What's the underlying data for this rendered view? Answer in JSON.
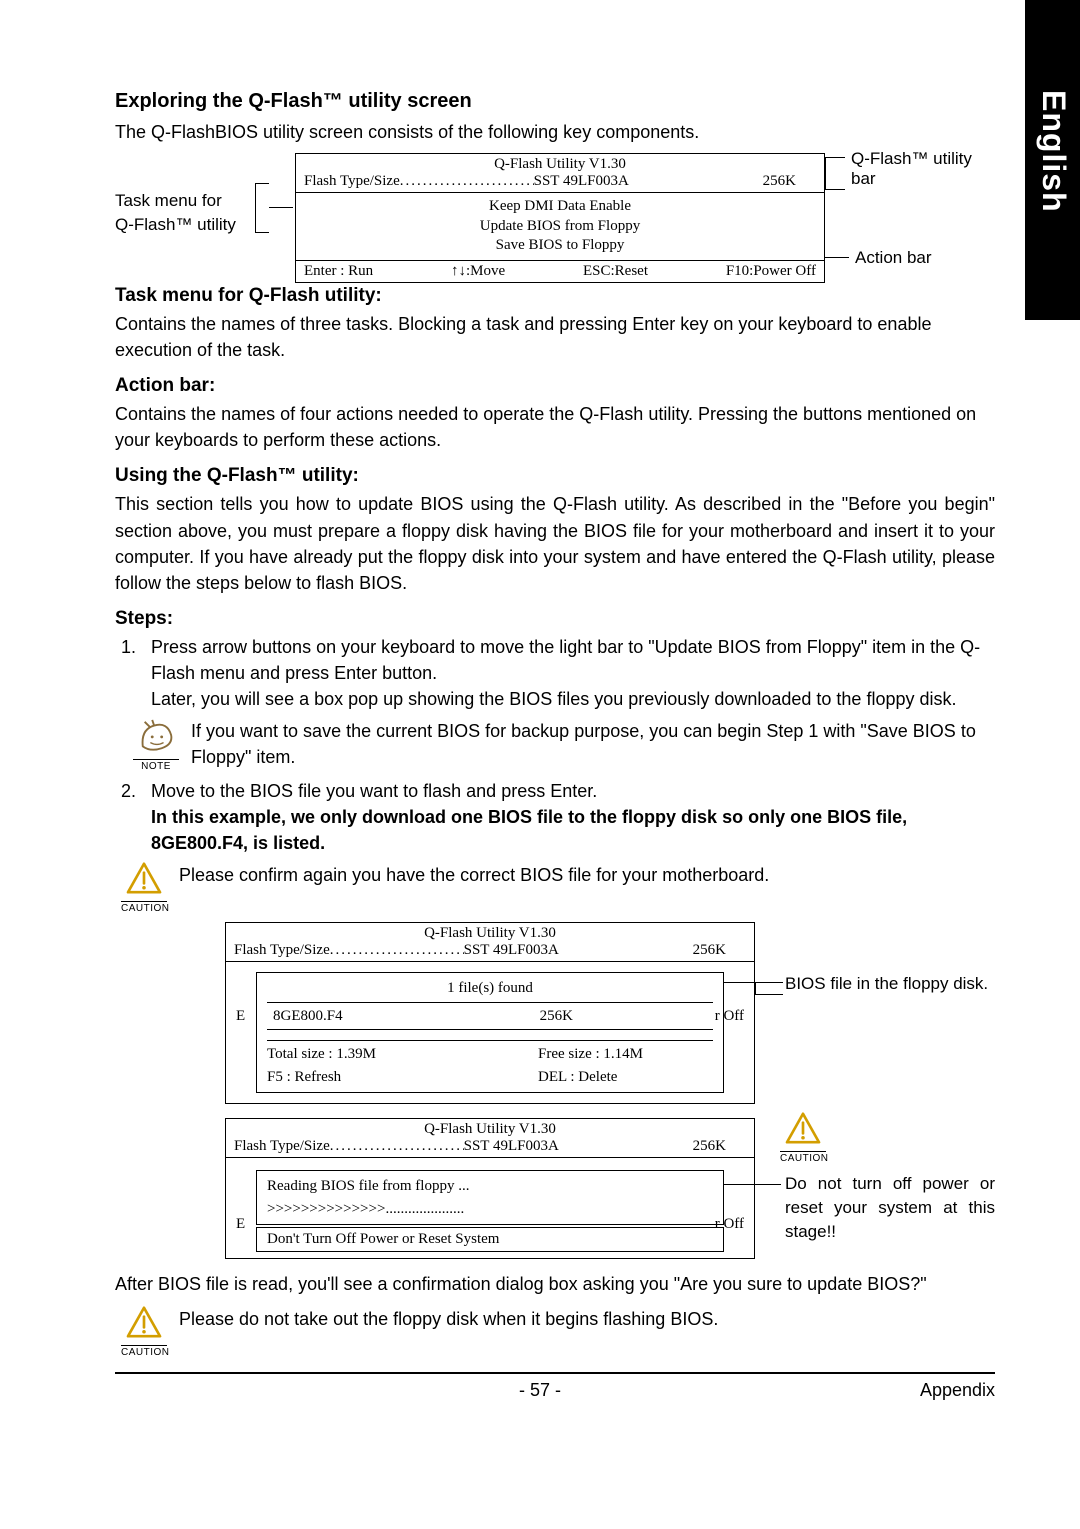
{
  "sideTab": "English",
  "heading1": "Exploring the Q-Flash™ utility screen",
  "intro1": "The Q-FlashBIOS utility screen consists of the following key components.",
  "diagram1": {
    "title": "Q-Flash Utility V1.30",
    "flashLabel": "Flash Type/Size",
    "flashValue": "SST 49LF003A",
    "flashSize": "256K",
    "menu1": "Keep DMI Data    Enable",
    "menu2": "Update BIOS from Floppy",
    "menu3": "Save BIOS to Floppy",
    "foot1": "Enter : Run",
    "foot2": "↑↓:Move",
    "foot3": "ESC:Reset",
    "foot4": "F10:Power Off",
    "labelLeft1": "Task menu for",
    "labelLeft2": "Q-Flash™ utility",
    "labelRight1": "Q-Flash™ utility bar",
    "labelRight2": "Action bar"
  },
  "h2_task": "Task menu for Q-Flash utility:",
  "p_task": "Contains the names of three tasks. Blocking a task and pressing Enter key on your keyboard to enable execution of the task.",
  "h2_action": "Action bar:",
  "p_action": "Contains the names of four actions needed to operate the Q-Flash utility. Pressing the buttons mentioned on your keyboards to perform these actions.",
  "h2_using": "Using the Q-Flash™ utility:",
  "p_using": "This section tells you how to update BIOS using the Q-Flash utility. As described in the \"Before you begin\" section above, you must prepare a floppy disk having the BIOS file for your motherboard and insert it to your computer. If you have already put the floppy disk into your system and have entered the Q-Flash utility, please follow the steps below to flash BIOS.",
  "h2_steps": "Steps:",
  "step1a": "Press arrow buttons on your keyboard to move the light bar to \"Update BIOS from Floppy\" item in the Q-Flash menu and press Enter button.",
  "step1b": "Later, you will see a box pop up showing the BIOS files you previously downloaded to the floppy disk.",
  "note1": "If you want to save the current BIOS for backup purpose, you can begin Step 1 with \"Save BIOS to Floppy\" item.",
  "noteWord": "NOTE",
  "step2a": "Move to the BIOS file you want to flash and press Enter.",
  "step2b": "In this example, we only download one BIOS file to the floppy disk so only one BIOS file, 8GE800.F4, is listed.",
  "caution1": "Please confirm again you have the correct BIOS file for your motherboard.",
  "cautionWord": "CAUTION",
  "diagram2": {
    "title": "Q-Flash Utility V1.30",
    "flashLabel": "Flash Type/Size",
    "flashValue": "SST 49LF003A",
    "flashSize": "256K",
    "filesFound": "1 file(s) found",
    "fileName": "8GE800.F4",
    "fileSize": "256K",
    "total": "Total size : 1.39M",
    "free": "Free size : 1.14M",
    "refresh": "F5 : Refresh",
    "del": "DEL : Delete",
    "leftE": "E",
    "rightOff": "r Off",
    "annot": "BIOS file in the floppy disk."
  },
  "diagram3": {
    "title": "Q-Flash Utility V1.30",
    "flashLabel": "Flash Type/Size",
    "flashValue": "SST 49LF003A",
    "flashSize": "256K",
    "reading": "Reading BIOS file from floppy ...",
    "chevrons": ">>>>>>>>>>>>>>",
    "dots": ".....................",
    "warn": "Don't Turn Off Power or Reset System",
    "leftE": "E",
    "rightOff": "r Off",
    "annot": "Do not turn off power or reset your system at this stage!!"
  },
  "afterRead": "After BIOS file is read, you'll see a confirmation dialog box asking you \"Are you sure to update BIOS?\"",
  "caution2": "Please do not take out the floppy disk when it begins flashing BIOS.",
  "pageNum": "- 57 -",
  "appendix": "Appendix"
}
